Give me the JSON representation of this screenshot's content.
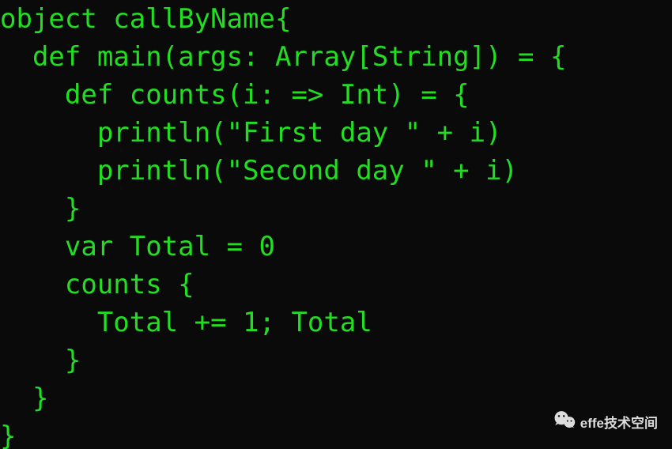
{
  "code": {
    "lines": [
      "object callByName{",
      "  def main(args: Array[String]) = {",
      "    def counts(i: => Int) = {",
      "      println(\"First day \" + i)",
      "      println(\"Second day \" + i)",
      "    }",
      "    var Total = 0",
      "    counts {",
      "      Total += 1; Total",
      "    }",
      "  }",
      "}"
    ]
  },
  "watermark": {
    "text": "effe技术空间"
  }
}
